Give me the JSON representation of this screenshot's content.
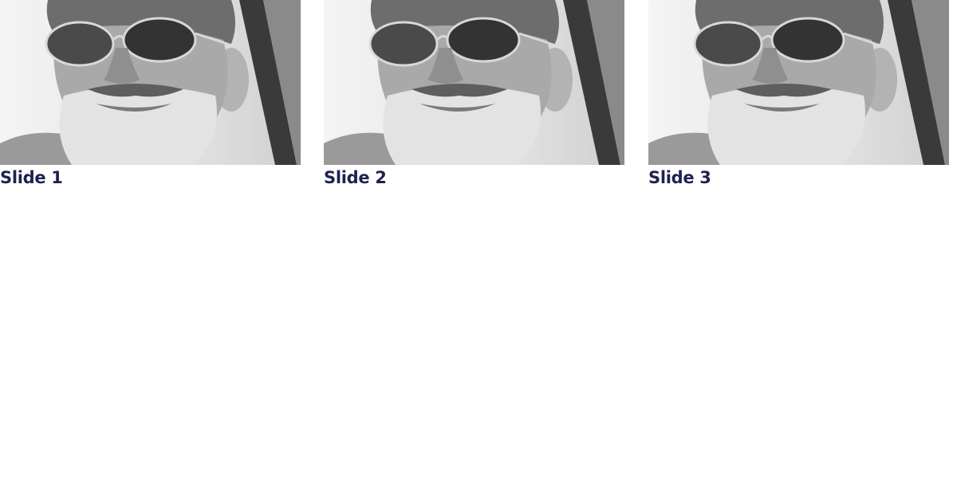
{
  "carousel": {
    "slides": [
      {
        "title": "Slide 1",
        "image": "portrait-photo"
      },
      {
        "title": "Slide 2",
        "image": "portrait-photo"
      },
      {
        "title": "Slide 3",
        "image": "portrait-photo"
      }
    ]
  },
  "colors": {
    "title_text": "#1d2250",
    "background": "#ffffff"
  }
}
